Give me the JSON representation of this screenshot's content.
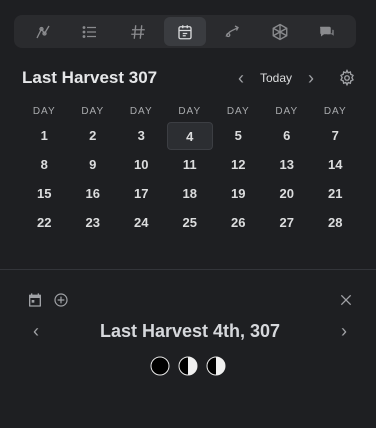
{
  "toolbar": {
    "items": [
      {
        "name": "locations-icon",
        "active": false
      },
      {
        "name": "list-icon",
        "active": false
      },
      {
        "name": "hash-icon",
        "active": false
      },
      {
        "name": "calendar-icon",
        "active": true
      },
      {
        "name": "link-icon",
        "active": false
      },
      {
        "name": "dice-icon",
        "active": false
      },
      {
        "name": "chat-icon",
        "active": false
      }
    ]
  },
  "calendar": {
    "title": "Last Harvest 307",
    "prev": "‹",
    "today_label": "Today",
    "next": "›",
    "day_headers": [
      "DAY",
      "DAY",
      "DAY",
      "DAY",
      "DAY",
      "DAY",
      "DAY"
    ],
    "days": [
      1,
      2,
      3,
      4,
      5,
      6,
      7,
      8,
      9,
      10,
      11,
      12,
      13,
      14,
      15,
      16,
      17,
      18,
      19,
      20,
      21,
      22,
      23,
      24,
      25,
      26,
      27,
      28
    ],
    "selected_day": 4
  },
  "detail": {
    "date_title": "Last Harvest 4th, 307",
    "prev": "‹",
    "next": "›",
    "moons": [
      "new-moon-icon",
      "first-quarter-moon-icon",
      "first-quarter-moon-icon"
    ]
  },
  "colors": {
    "background": "#1e1f22",
    "toolbar_bg": "#2a2b2e",
    "selected_cell": "#2c2e32"
  }
}
